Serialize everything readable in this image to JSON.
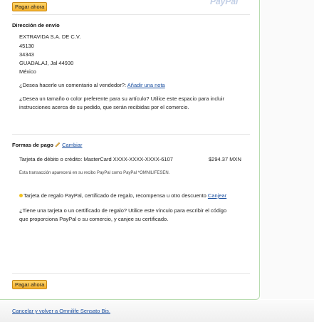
{
  "brand_text": "PayPal",
  "buttons": {
    "pay_now": "Pagar ahora"
  },
  "shipping": {
    "heading": "Dirección de envío",
    "lines": [
      "EXTRAVIDA S.A. DE C.V.",
      "45130",
      "34343",
      "GUADALAJ, Jal 44930",
      "México"
    ],
    "comment_question": "¿Desea hacerle un comentario al vendedor?:",
    "add_note_link": "Añadir una nota",
    "size_color_line1": "¿Desea un tamaño o color preferente para su artículo? Utilice este espacio para incluir",
    "size_color_line2": "instrucciones acerca de su pedido, que serán recibidas por el comercio."
  },
  "payment": {
    "heading": "Formas de pago",
    "change_link": "Cambiar",
    "card_line": "Tarjeta de débito o crédito: MasterCard XXXX-XXXX-XXXX-6107",
    "amount": "$294.37 MXN",
    "statement_note": "Esta transacción aparecerá en su recibo PayPal como PayPal *OMNILIFESEN.",
    "gift_line": "Tarjeta de regalo PayPal, certificado de regalo, recompensa u otro descuento",
    "gift_link": "Canjear",
    "gift_help_line1": "¿Tiene una tarjeta o un certificado de regalo? Utilice este vínculo para escribir el código",
    "gift_help_line2": "que proporciona PayPal o su comercio, y canjee su certificado."
  },
  "footer": {
    "cancel_link": "Cancelar y volver a Omnilife Sensato Bis."
  }
}
